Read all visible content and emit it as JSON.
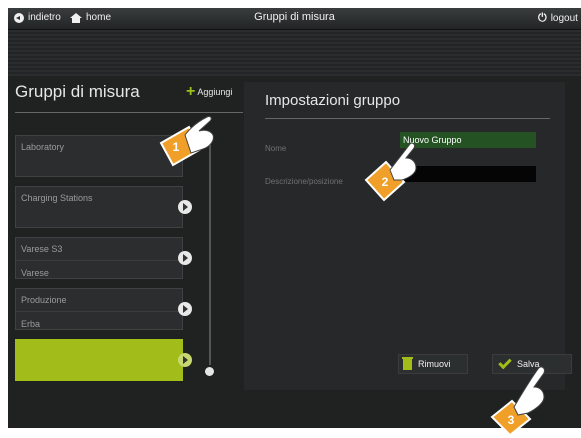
{
  "topbar": {
    "back_label": "indietro",
    "home_label": "home",
    "title": "Gruppi di misura",
    "logout_label": "logout"
  },
  "left": {
    "title": "Gruppi di misura",
    "add_label": "Aggiungi",
    "groups": [
      {
        "name": "Laboratory",
        "sub": ""
      },
      {
        "name": "Charging Stations",
        "sub": ""
      },
      {
        "name": "Varese S3",
        "sub": "Varese"
      },
      {
        "name": "Produzione",
        "sub": "Erba"
      },
      {
        "name": "",
        "sub": ""
      }
    ]
  },
  "right": {
    "title": "Impostazioni gruppo",
    "name_label": "Nome",
    "name_value": "Nuovo Gruppo",
    "desc_label": "Descrizione/posizione",
    "desc_value": "",
    "remove_label": "Rimuovi",
    "save_label": "Salva"
  },
  "callouts": [
    "1",
    "2",
    "3"
  ],
  "colors": {
    "accent": "#a2bc1a",
    "name_field_bg": "#245223",
    "callout": "#f0a028"
  }
}
